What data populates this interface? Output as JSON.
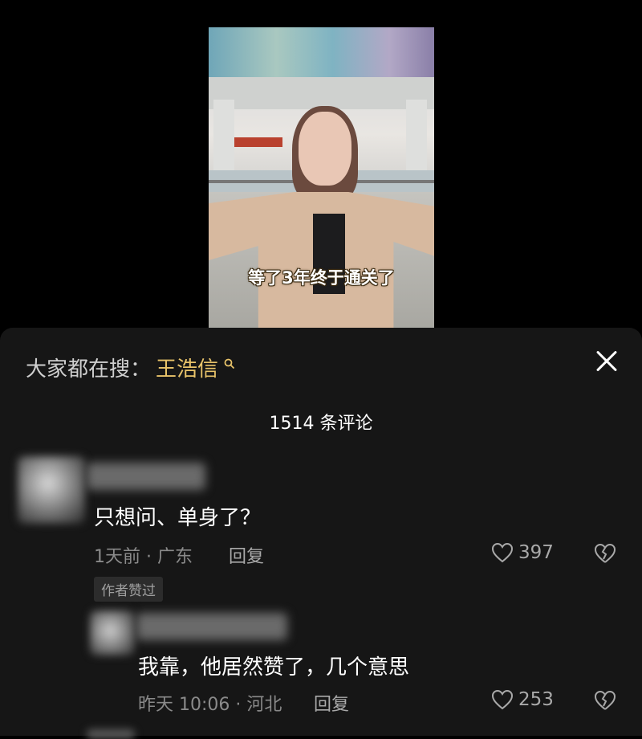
{
  "video": {
    "caption": "等了3年终于通关了"
  },
  "sheet": {
    "search_prefix": "大家都在搜：",
    "search_keyword": "王浩信",
    "comment_count": "1514 条评论"
  },
  "comments": [
    {
      "text": "只想问、单身了？",
      "meta": "1天前 · 广东",
      "reply_label": "回复",
      "likes": "397",
      "badge": "作者赞过"
    },
    {
      "text": "我靠，他居然赞了，几个意思",
      "meta": "昨天 10:06 · 河北",
      "reply_label": "回复",
      "likes": "253"
    }
  ],
  "colors": {
    "keyword": "#e9c46a",
    "sheet_bg": "#161616",
    "muted": "#8a8a8a"
  }
}
